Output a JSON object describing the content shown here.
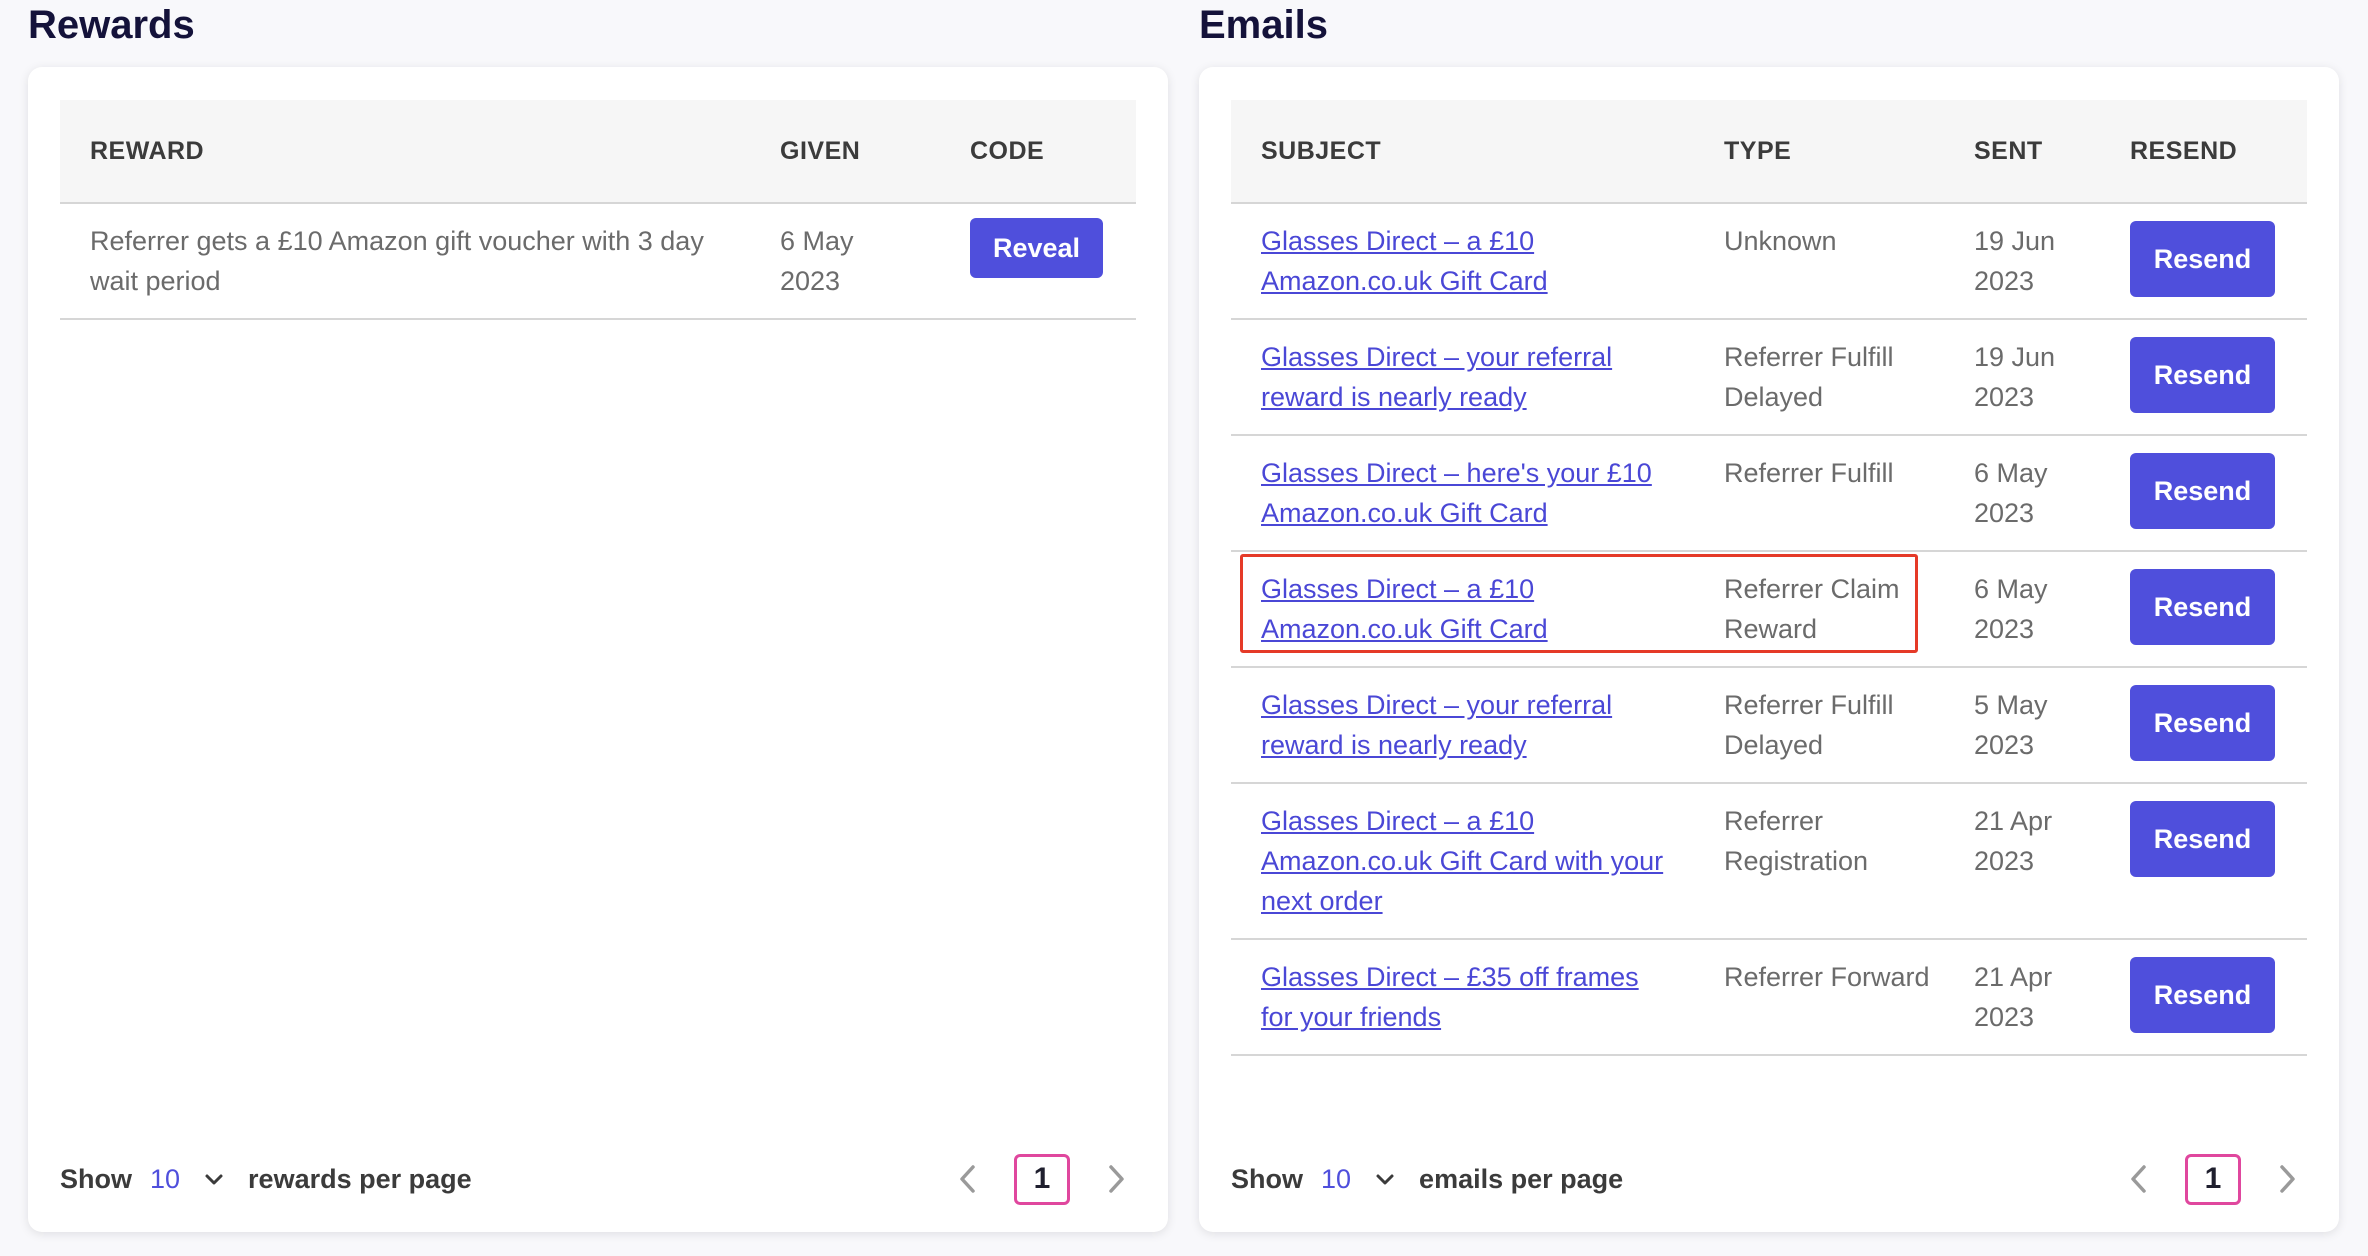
{
  "rewards": {
    "title": "Rewards",
    "columns": [
      "REWARD",
      "GIVEN",
      "CODE"
    ],
    "rows": [
      {
        "reward": "Referrer gets a £10 Amazon gift voucher with 3 day wait period",
        "given": "6 May 2023",
        "action": "Reveal"
      }
    ],
    "footer": {
      "show": "Show",
      "per_page_value": "10",
      "per_page_label": "rewards per page",
      "page": "1"
    }
  },
  "emails": {
    "title": "Emails",
    "columns": [
      "SUBJECT",
      "TYPE",
      "SENT",
      "RESEND"
    ],
    "rows": [
      {
        "subject": "Glasses Direct – a £10 Amazon.co.uk Gift Card",
        "type": "Unknown",
        "sent": "19 Jun 2023",
        "action": "Resend"
      },
      {
        "subject": "Glasses Direct – your referral reward is nearly ready",
        "type": "Referrer Fulfill Delayed",
        "sent": "19 Jun 2023",
        "action": "Resend"
      },
      {
        "subject": "Glasses Direct – here's your £10 Amazon.co.uk Gift Card",
        "type": "Referrer Fulfill",
        "sent": "6 May 2023",
        "action": "Resend"
      },
      {
        "subject": "Glasses Direct – a £10 Amazon.co.uk Gift Card",
        "type": "Referrer Claim Reward",
        "sent": "6 May 2023",
        "action": "Resend"
      },
      {
        "subject": "Glasses Direct – your referral reward is nearly ready",
        "type": "Referrer Fulfill Delayed",
        "sent": "5 May 2023",
        "action": "Resend"
      },
      {
        "subject": "Glasses Direct – a £10 Amazon.co.uk Gift Card with your next order",
        "type": "Referrer Registration",
        "sent": "21 Apr 2023",
        "action": "Resend"
      },
      {
        "subject": "Glasses Direct – £35 off frames for your friends",
        "type": "Referrer Forward",
        "sent": "21 Apr 2023",
        "action": "Resend"
      }
    ],
    "footer": {
      "show": "Show",
      "per_page_value": "10",
      "per_page_label": "emails per page",
      "page": "1"
    }
  },
  "icons": {
    "chevron_down": "chevron-down-icon",
    "chevron_left": "chevron-left-icon",
    "chevron_right": "chevron-right-icon"
  },
  "colors": {
    "accent": "#4f4fdc",
    "link": "#4a47d6",
    "page_highlight": "#e0479e",
    "annotation_box": "#e53a28"
  }
}
